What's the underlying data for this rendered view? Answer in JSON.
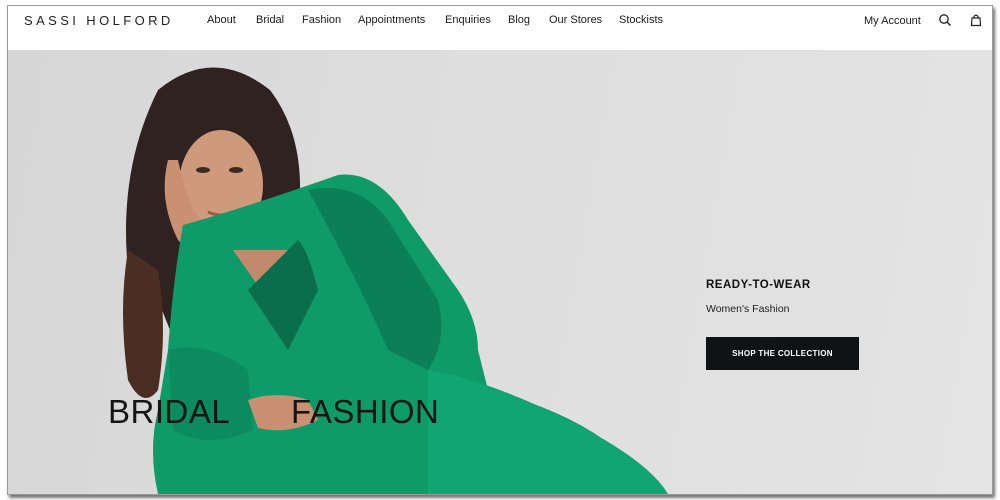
{
  "header": {
    "logo": "SASSI HOLFORD",
    "nav": [
      {
        "label": "About"
      },
      {
        "label": "Bridal"
      },
      {
        "label": "Fashion"
      },
      {
        "label": "Appointments"
      },
      {
        "label": "Enquiries"
      },
      {
        "label": "Blog"
      },
      {
        "label": "Our Stores"
      },
      {
        "label": "Stockists"
      }
    ],
    "account": "My Account",
    "icons": [
      "search-icon",
      "shopping-bag-icon"
    ]
  },
  "hero": {
    "title_left": "BRIDAL",
    "title_right": "FASHION",
    "heading": "READY-TO-WEAR",
    "subheading": "Women's Fashion",
    "cta": "SHOP THE COLLECTION",
    "suit_color": "#0f9a6a"
  }
}
